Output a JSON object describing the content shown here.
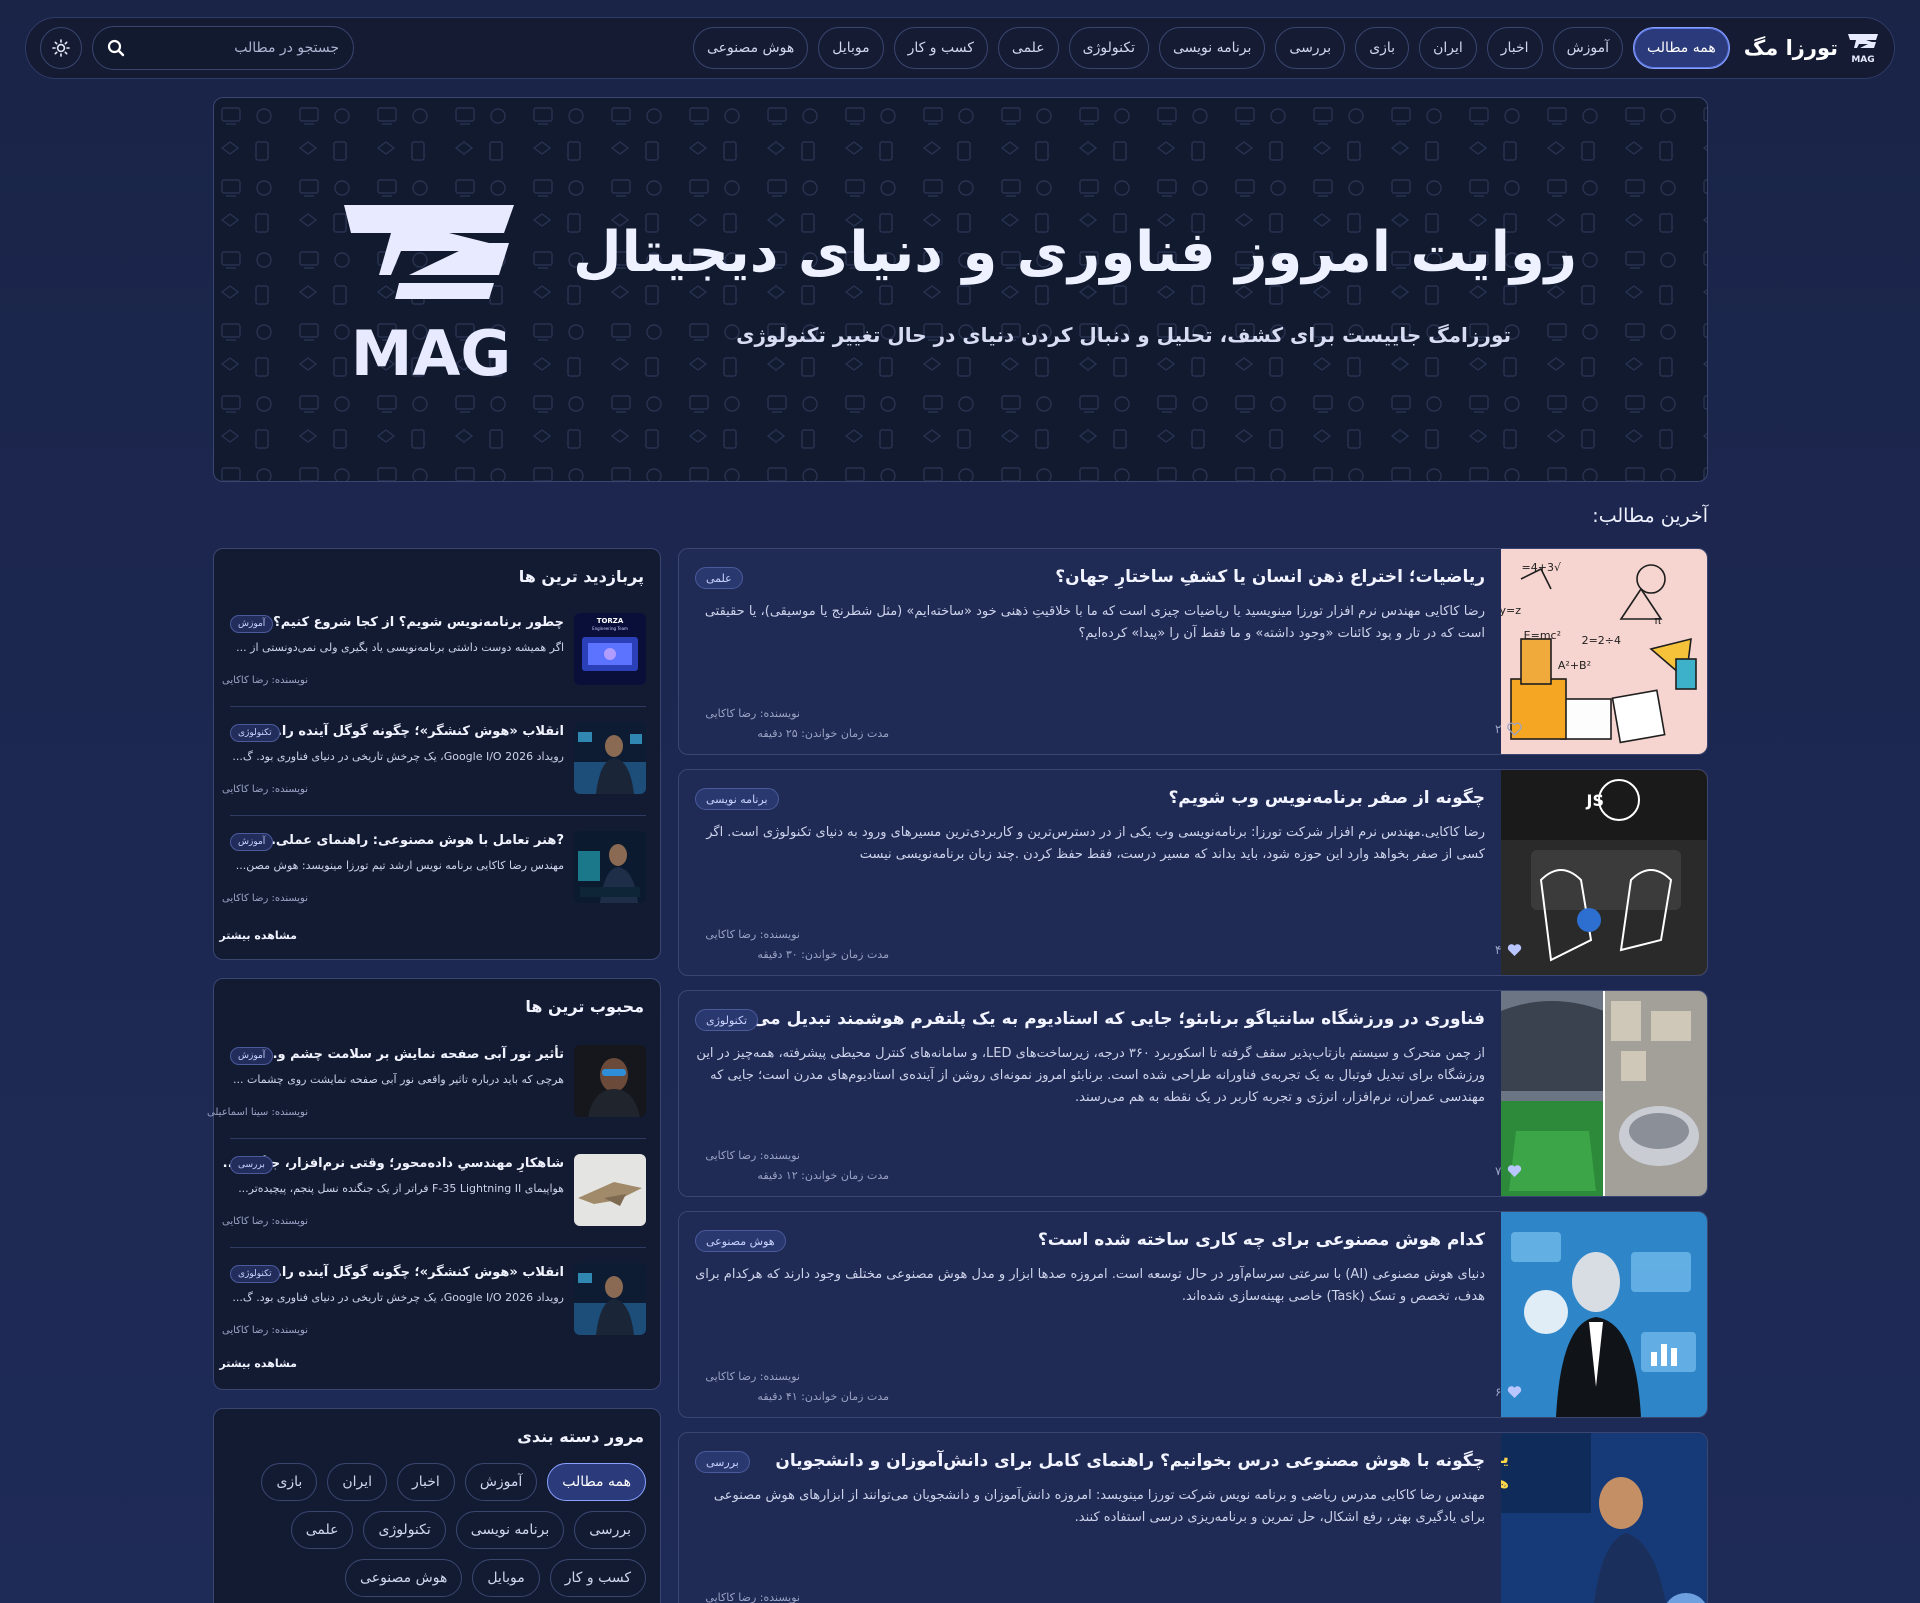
{
  "brand": {
    "name": "تورزا مگ",
    "logo_text": "MAG"
  },
  "nav": {
    "items": [
      "همه مطالب",
      "آموزش",
      "اخبار",
      "ایران",
      "بازی",
      "بررسی",
      "برنامه نویسی",
      "تکنولوژی",
      "علمی",
      "کسب و کار",
      "موبایل",
      "هوش مصنوعی"
    ],
    "active_index": 0
  },
  "search": {
    "placeholder": "جستجو در مطالب"
  },
  "hero": {
    "title": "روایت امروز فناوری و دنیای دیجیتال",
    "subtitle": "تورزامگ جاییست برای کشف، تحلیل و دنبال کردن دنیای در حال تغییر تکنولوژی",
    "logo_text": "MAG"
  },
  "latest": {
    "heading": "آخرین مطالب:"
  },
  "articles": [
    {
      "title": "ریاضیات؛ اختراع ذهن انسان یا کشفِ ساختارِ جهان؟",
      "tag": "علمی",
      "excerpt": "رضا کاکایی مهندس نرم افزار تورزا مینویسید یا ریاضیات چیزی است که ما با خلاقیتِ ذهنی خود «ساخته‌ایم» (مثل شطرنج یا موسیقی)، یا حقیقتی است که در تار و پود کائنات «وجود داشته» و ما فقط آن را «پیدا» کرده‌ایم؟",
      "author": "نویسنده: رضا کاکایی",
      "read_time": "مدت زمان خواندن: ۲۵ دقیقه",
      "likes": "۲",
      "liked": false
    },
    {
      "title": "چگونه از صفر برنامه‌نویس وب شویم؟",
      "tag": "برنامه نویسی",
      "excerpt": "رضا کاکایی.مهندس نرم افزار شرکت تورزا: برنامه‌نویسی وب یکی از در دسترس‌ترین و کاربردی‌ترین مسیرهای ورود به دنیای تکنولوژی است. اگر کسی از صفر بخواهد وارد این حوزه شود، باید بداند که مسیر درست، فقط حفظ کردن .چند زبان برنامه‌نویسی نیست",
      "author": "نویسنده: رضا کاکایی",
      "read_time": "مدت زمان خواندن: ۳۰ دقیقه",
      "likes": "۴",
      "liked": true
    },
    {
      "title": "فناوری در ورزشگاه سانتیاگو برنابئو؛ جایی که استادیوم به یک پلتفرم هوشمند تبدیل می‌شود",
      "tag": "تکنولوژی",
      "excerpt": "از چمن متحرک و سیستم بازتاب‌پذیر سقف گرفته تا اسکوربرد ۳۶۰ درجه، زیرساخت‌های LED، و سامانه‌های کنترل محیطی پیشرفته، همه‌چیز در این ورزشگاه برای تبدیل فوتبال به یک تجربه‌ی فناورانه طراحی شده است. برنابئو امروز نمونه‌ای روشن از آینده‌ی استادیوم‌های مدرن است؛ جایی که مهندسی عمران، نرم‌افزار، انرژی و تجربه کاربر در یک نقطه به هم می‌رسند.",
      "author": "نویسنده: رضا کاکایی",
      "read_time": "مدت زمان خواندن: ۱۲ دقیقه",
      "likes": "۷",
      "liked": true
    },
    {
      "title": "کدام هوش مصنوعی برای چه کاری ساخته شده است؟",
      "tag": "هوش مصنوعی",
      "excerpt": "دنیای هوش مصنوعی (AI) با سرعتی سرسام‌آور در حال توسعه است. امروزه صدها ابزار و مدل هوش مصنوعی مختلف وجود دارند که هرکدام برای هدف، تخصص و تسک (Task) خاصی بهینه‌سازی شده‌اند.",
      "author": "نویسنده: رضا کاکایی",
      "read_time": "مدت زمان خواندن: ۴۱ دقیقه",
      "likes": "۶",
      "liked": true
    },
    {
      "title": "چگونه با هوش مصنوعی درس بخوانیم؟ راهنمای کامل برای دانش‌آموزان و دانشجویان",
      "tag": "بررسی",
      "excerpt": "مهندس رضا کاکایی مدرس ریاضی و برنامه نویس شرکت تورزا مینویسد: امروزه دانش‌آموزان و دانشجویان می‌توانند از ابزارهای هوش مصنوعی برای یادگیری بهتر، رفع اشکال، حل تمرین و برنامه‌ریزی درسی استفاده کنند.",
      "author": "نویسنده: رضا کاکایی",
      "read_time": "",
      "likes": "",
      "liked": false
    }
  ],
  "most_viewed": {
    "title": "پربازدید ترین ها",
    "more": "مشاهده بیشتر",
    "items": [
      {
        "title": "چطور برنامه‌نویس شویم؟ از کجا شروع کنیم؟ 💻",
        "tag": "آموزش",
        "excerpt": "اگر همیشه دوست داشتی برنامه‌نویسی یاد بگیری ولی نمی‌دونستی از ...",
        "author": "نویسنده: رضا کاکایی",
        "thumb_text": "TORZA Engineering Team"
      },
      {
        "title": "انقلاب «هوش کنشگر»؛ چگونه گوگل آینده را...",
        "tag": "تکنولوژی",
        "excerpt": "رویداد Google I/O 2026، یک چرخش تاریخی در دنیای فناوری بود. گ...",
        "author": "نویسنده: رضا کاکایی",
        "thumb_text": ""
      },
      {
        "title": "?هنر تعامل با هوش مصنوعی: راهنمای عملی...",
        "tag": "آموزش",
        "excerpt": "مهندس رضا کاکایی برنامه نویس ارشد تیم تورزا مینویسد: هوش مصن...",
        "author": "نویسنده: رضا کاکایی",
        "thumb_text": ""
      }
    ]
  },
  "most_liked": {
    "title": "محبوب ترین ها",
    "more": "مشاهده بیشتر",
    "items": [
      {
        "title": "تأثیر نور آبی صفحه نمایش بر سلامت چشم و...",
        "tag": "آموزش",
        "excerpt": "هرچی که باید درباره تاثیر واقعی نور آبی صفحه نمایشت روی چشمات ...",
        "author": "نویسنده: سینا اسماعیلی"
      },
      {
        "title": "شاهکارِ مهندسیِ داده‌محور؛ وقتی نرم‌افزار، جنگنده...",
        "tag": "بررسی",
        "excerpt": "هواپیمای F-35 Lightning II فراتر از یک جنگنده نسل پنجم، پیچیده‌تر...",
        "author": "نویسنده: رضا کاکایی"
      },
      {
        "title": "انقلاب «هوش کنشگر»؛ چگونه گوگل آینده را...",
        "tag": "تکنولوژی",
        "excerpt": "رویداد Google I/O 2026، یک چرخش تاریخی در دنیای فناوری بود. گ...",
        "author": "نویسنده: رضا کاکایی"
      }
    ]
  },
  "categories": {
    "title": "مرور دسته بندی",
    "items": [
      "همه مطالب",
      "آموزش",
      "اخبار",
      "ایران",
      "بازی",
      "بررسی",
      "برنامه نویسی",
      "تکنولوژی",
      "علمی",
      "کسب و کار",
      "موبایل",
      "هوش مصنوعی"
    ],
    "active_index": 0
  },
  "colors": {
    "accent": "#8aa2ff",
    "card_bg": "#1f2a55",
    "page_bg": "#1c2750"
  }
}
